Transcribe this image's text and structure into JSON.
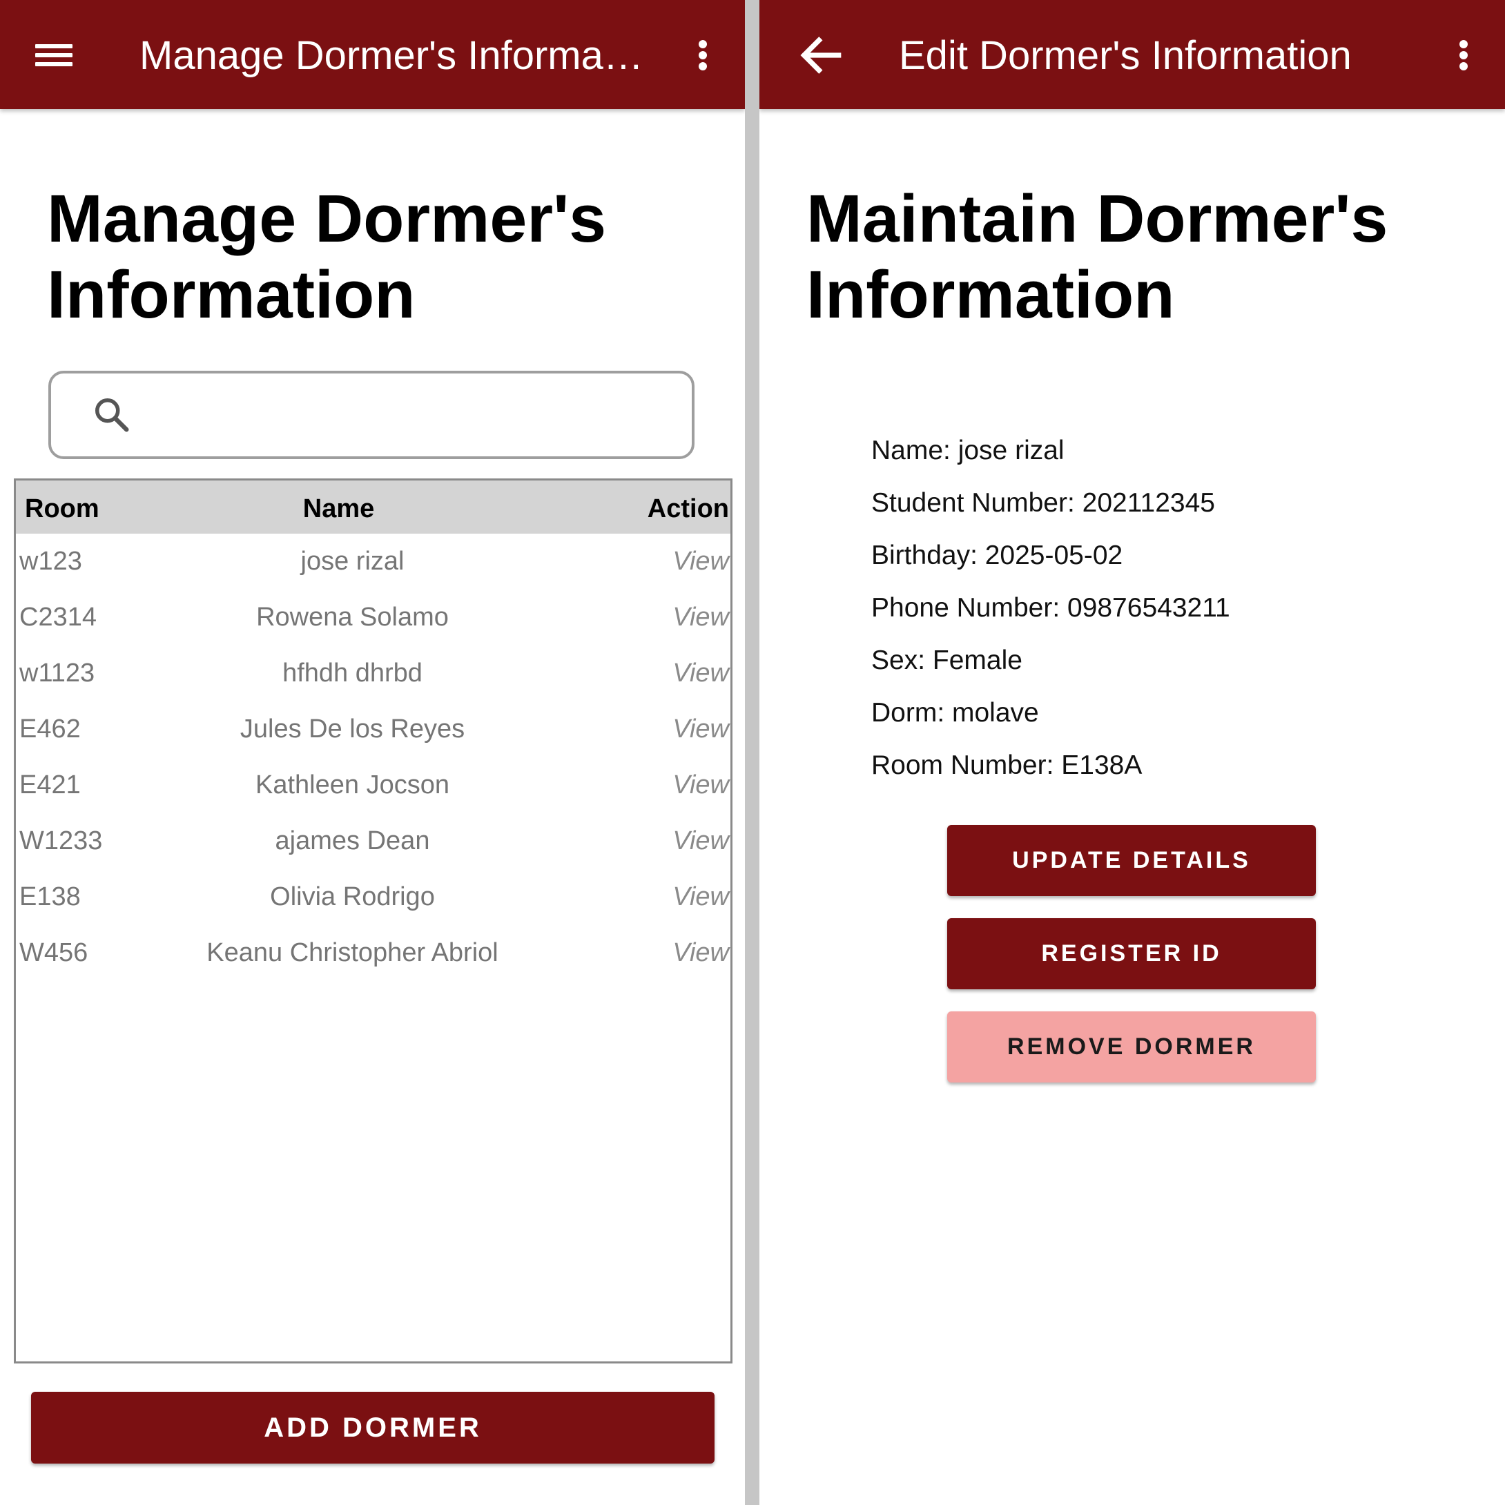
{
  "left_screen": {
    "appbar_title": "Manage Dormer's Informat...",
    "page_title": "Manage Dormer's Information",
    "search": {
      "placeholder": ""
    },
    "table": {
      "headers": {
        "room": "Room",
        "name": "Name",
        "action": "Action"
      },
      "rows": [
        {
          "room": "w123",
          "name": "jose rizal",
          "action": "View"
        },
        {
          "room": "C2314",
          "name": "Rowena Solamo",
          "action": "View"
        },
        {
          "room": "w1123",
          "name": "hfhdh dhrbd",
          "action": "View"
        },
        {
          "room": "E462",
          "name": "Jules De los Reyes",
          "action": "View"
        },
        {
          "room": "E421",
          "name": "Kathleen Jocson",
          "action": "View"
        },
        {
          "room": "W1233",
          "name": "ajames Dean",
          "action": "View"
        },
        {
          "room": "E138",
          "name": "Olivia Rodrigo",
          "action": "View"
        },
        {
          "room": "W456",
          "name": "Keanu Christopher Abriol",
          "action": "View"
        }
      ]
    },
    "add_button": "ADD DORMER"
  },
  "right_screen": {
    "appbar_title": "Edit Dormer's Information",
    "page_title": "Maintain Dormer's Information",
    "details": [
      "Name: jose rizal",
      "Student Number: 202112345",
      "Birthday: 2025-05-02",
      "Phone Number: 09876543211",
      "Sex: Female",
      "Dorm: molave",
      "Room Number: E138A"
    ],
    "buttons": {
      "update": "UPDATE DETAILS",
      "register": "REGISTER ID",
      "remove": "REMOVE DORMER"
    }
  },
  "icons": {
    "menu": "menu-icon",
    "more": "kebab-menu-icon",
    "back": "arrow-back-icon",
    "search": "search-icon"
  },
  "colors": {
    "primary": "#7b1012",
    "danger_light": "#f4a3a2",
    "header_row": "#d4d4d4",
    "divider": "#c6c6c6"
  }
}
